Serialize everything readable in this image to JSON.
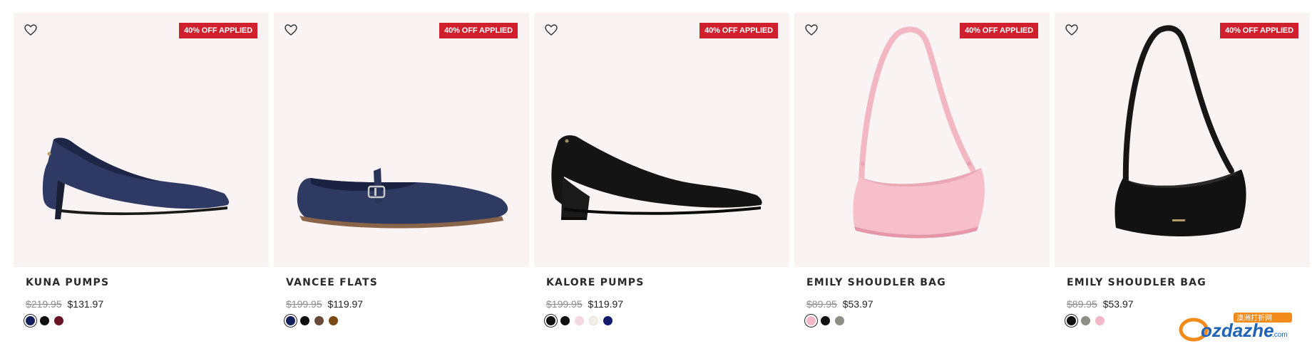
{
  "products": [
    {
      "name": "KUNA PUMPS",
      "badge": "40% OFF APPLIED",
      "was_price": "$219.95",
      "price": "$131.97",
      "image": "navy-suede-pump",
      "swatches": [
        "#131f5c",
        "#111111",
        "#6a1426"
      ]
    },
    {
      "name": "VANCEE FLATS",
      "badge": "40% OFF APPLIED",
      "was_price": "$199.95",
      "price": "$119.97",
      "image": "navy-mary-jane-flat",
      "swatches": [
        "#131f5c",
        "#111111",
        "#6b4a3a",
        "#7a4a16"
      ]
    },
    {
      "name": "KALORE PUMPS",
      "badge": "40% OFF APPLIED",
      "was_price": "$199.95",
      "price": "$119.97",
      "image": "black-block-heel-pump",
      "swatches": [
        "#111111",
        "#111111",
        "#f3d9df",
        "#f1efe8",
        "#121a6e"
      ]
    },
    {
      "name": "EMILY SHOUDLER BAG",
      "badge": "40% OFF APPLIED",
      "was_price": "$89.95",
      "price": "$53.97",
      "image": "pink-shoulder-bag",
      "swatches": [
        "#f3b8c8",
        "#111111",
        "#8c8f84"
      ]
    },
    {
      "name": "EMILY SHOUDLER BAG",
      "badge": "40% OFF APPLIED",
      "was_price": "$89.95",
      "price": "$53.97",
      "image": "black-shoulder-bag",
      "swatches": [
        "#111111",
        "#8c8f84",
        "#f3b8c8"
      ]
    }
  ],
  "colors": {
    "badge": "#d0202e",
    "card_bg": "#faf3f3",
    "strike": "#8d8d8d"
  },
  "watermark": {
    "text": "ozdazhe",
    "suffix": ".com",
    "cn": "澳洲打折网"
  }
}
